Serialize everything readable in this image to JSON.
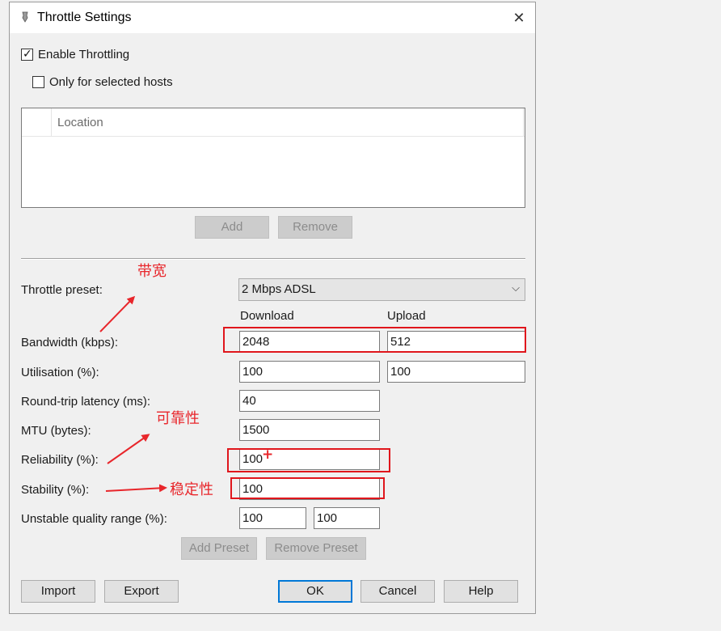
{
  "window": {
    "title": "Throttle Settings",
    "close_glyph": "✕"
  },
  "enable_throttling": {
    "label": "Enable Throttling",
    "checked": true,
    "mark": "✓"
  },
  "only_selected_hosts": {
    "label": "Only for selected hosts",
    "checked": false
  },
  "hosts_list": {
    "column_location": "Location",
    "rows": []
  },
  "host_buttons": {
    "add": "Add",
    "remove": "Remove"
  },
  "preset": {
    "label": "Throttle preset:",
    "value": "2 Mbps ADSL",
    "chevron": "⌵"
  },
  "columns": {
    "download": "Download",
    "upload": "Upload"
  },
  "fields": {
    "bandwidth": {
      "label": "Bandwidth (kbps):",
      "download": "2048",
      "upload": "512"
    },
    "utilisation": {
      "label": "Utilisation (%):",
      "download": "100",
      "upload": "100"
    },
    "latency": {
      "label": "Round-trip latency (ms):",
      "value": "40"
    },
    "mtu": {
      "label": "MTU (bytes):",
      "value": "1500"
    },
    "reliability": {
      "label": "Reliability (%):",
      "value": "100"
    },
    "stability": {
      "label": "Stability (%):",
      "value": "100"
    },
    "unstable_range": {
      "label": "Unstable quality range (%):",
      "min": "100",
      "max": "100"
    }
  },
  "preset_buttons": {
    "add": "Add Preset",
    "remove": "Remove Preset"
  },
  "footer_buttons": {
    "import": "Import",
    "export": "Export",
    "ok": "OK",
    "cancel": "Cancel",
    "help": "Help"
  },
  "annotations": {
    "bandwidth": "带宽",
    "reliability": "可靠性",
    "stability": "稳定性",
    "cursor_mark": "+",
    "color": "#e8262b"
  },
  "colors": {
    "focus_border": "#0078d7",
    "annotation_red": "#e0161c"
  }
}
